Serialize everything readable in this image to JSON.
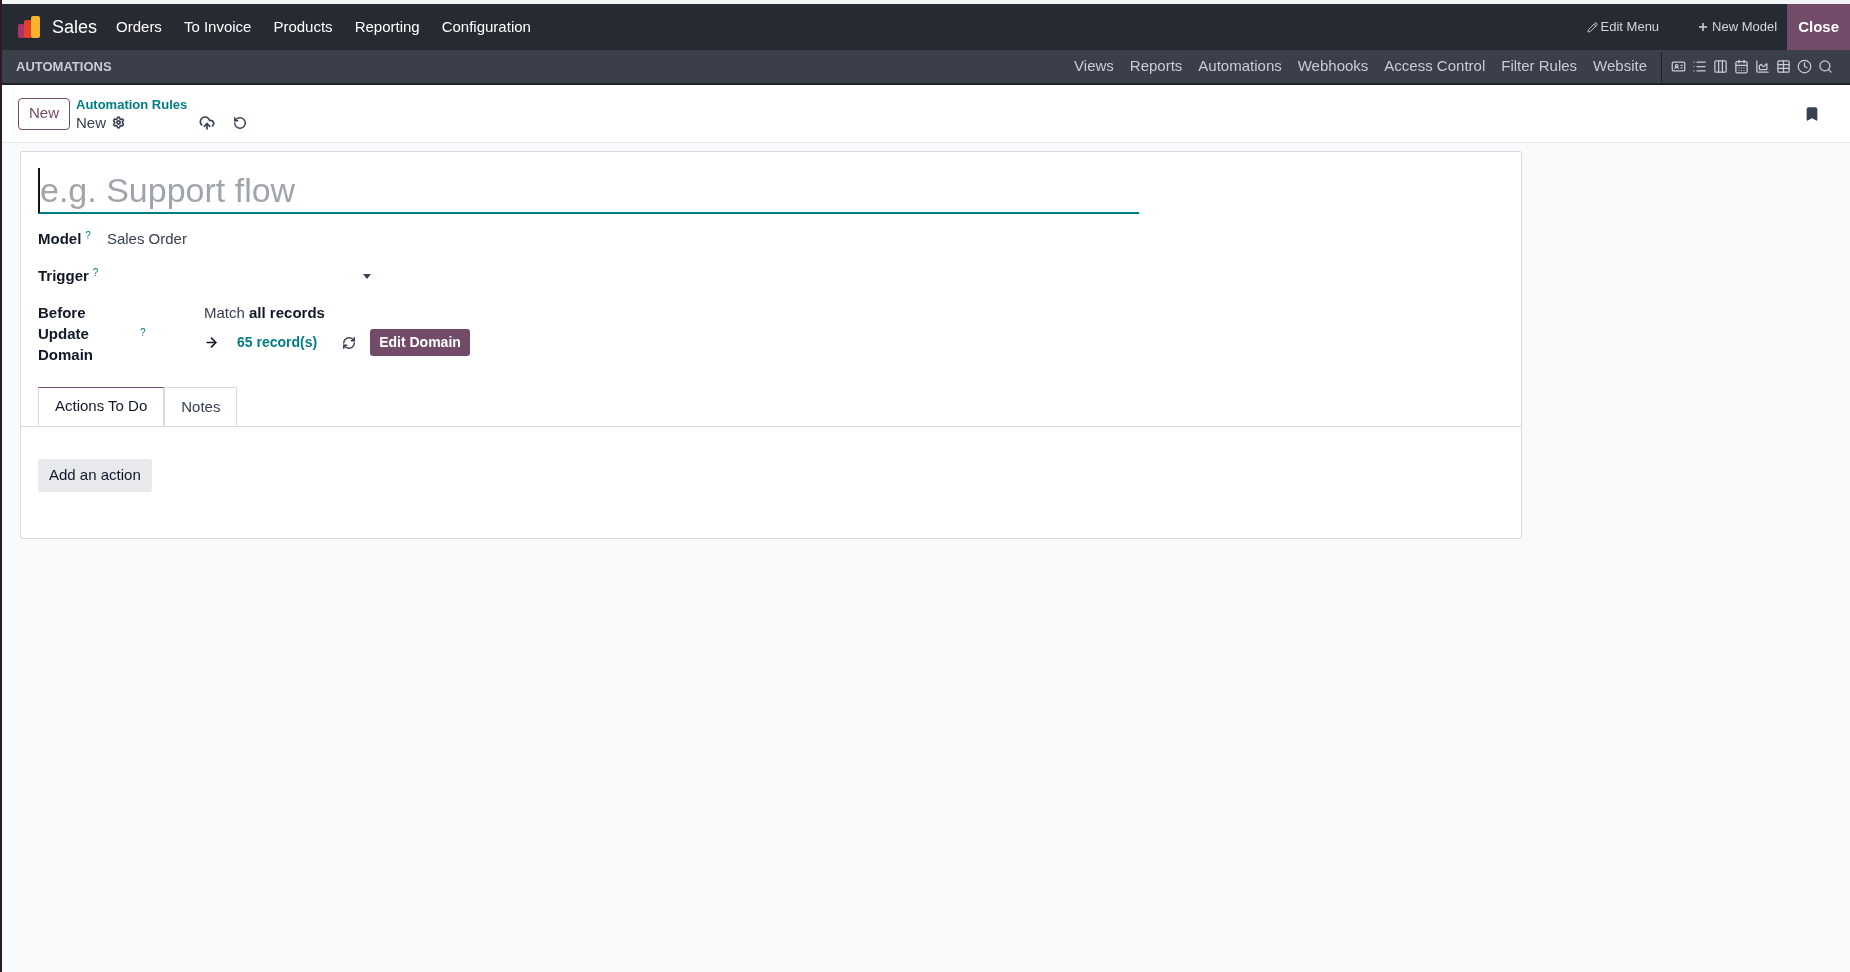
{
  "navbar": {
    "app_name": "Sales",
    "menu": [
      "Orders",
      "To Invoice",
      "Products",
      "Reporting",
      "Configuration"
    ],
    "actions": [
      {
        "kind": "edit",
        "label": "Edit Menu"
      },
      {
        "kind": "add",
        "label": "New Model"
      }
    ],
    "close": "Close"
  },
  "subbar": {
    "title": "AUTOMATIONS",
    "links": [
      "Views",
      "Reports",
      "Automations",
      "Webhooks",
      "Access Control",
      "Filter Rules",
      "Website"
    ]
  },
  "control_panel": {
    "new_button": "New",
    "breadcrumb": "Automation Rules",
    "record": "New"
  },
  "form": {
    "name_placeholder": "e.g. Support flow",
    "fields": [
      {
        "kind": "text",
        "label": "Model",
        "help": "?",
        "value": "Sales Order"
      },
      {
        "kind": "select",
        "label": "Trigger",
        "help": "?"
      },
      {
        "kind": "domain",
        "label": "Before Update Domain",
        "help": "?",
        "match": "Match **all records**",
        "count": "65 record(s)",
        "button": "Edit Domain"
      }
    ],
    "tabs": [
      {
        "label": "Actions To Do",
        "selected": true
      },
      {
        "label": "Notes",
        "selected": false
      }
    ],
    "add_button": "Add an action"
  }
}
